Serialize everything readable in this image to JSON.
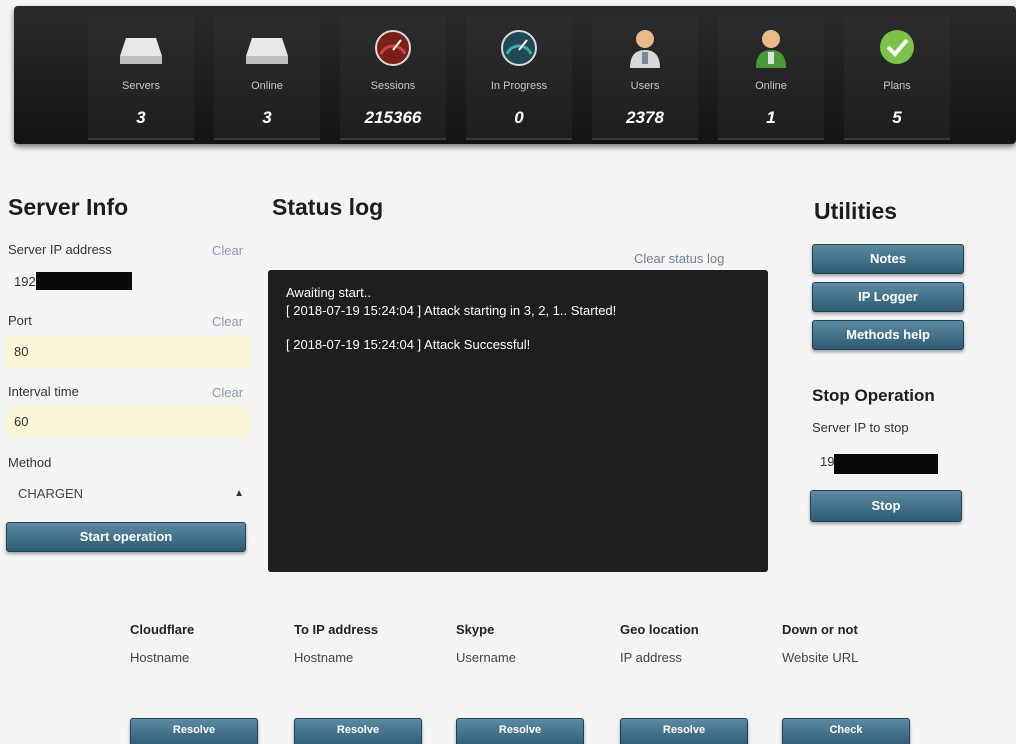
{
  "stats": [
    {
      "label": "Servers",
      "value": "3",
      "icon": "server-icon"
    },
    {
      "label": "Online",
      "value": "3",
      "icon": "server-icon"
    },
    {
      "label": "Sessions",
      "value": "215366",
      "icon": "gauge-icon"
    },
    {
      "label": "In Progress",
      "value": "0",
      "icon": "gauge-icon"
    },
    {
      "label": "Users",
      "value": "2378",
      "icon": "user-icon"
    },
    {
      "label": "Online",
      "value": "1",
      "icon": "user-icon"
    },
    {
      "label": "Plans",
      "value": "5",
      "icon": "check-icon"
    }
  ],
  "server_info": {
    "title": "Server Info",
    "ip_label": "Server IP address",
    "ip_value": "192",
    "port_label": "Port",
    "port_value": "80",
    "interval_label": "Interval time",
    "interval_value": "60",
    "method_label": "Method",
    "method_value": "CHARGEN",
    "clear_label": "Clear",
    "start_button": "Start operation"
  },
  "status_log": {
    "title": "Status log",
    "clear_link": "Clear status log",
    "lines": [
      "Awaiting start..",
      "[ 2018-07-19 15:24:04 ] Attack starting in 3, 2, 1.. Started!",
      "[ 2018-07-19 15:24:04 ] Attack Successful!"
    ]
  },
  "utilities": {
    "title": "Utilities",
    "notes_button": "Notes",
    "ip_logger_button": "IP Logger",
    "methods_help_button": "Methods help",
    "stop_title": "Stop Operation",
    "stop_ip_label": "Server IP to stop",
    "stop_ip_value": "19",
    "stop_button": "Stop"
  },
  "tools": [
    {
      "title": "Cloudflare",
      "placeholder": "Hostname",
      "button": "Resolve"
    },
    {
      "title": "To IP address",
      "placeholder": "Hostname",
      "button": "Resolve"
    },
    {
      "title": "Skype",
      "placeholder": "Username",
      "button": "Resolve"
    },
    {
      "title": "Geo location",
      "placeholder": "IP address",
      "button": "Resolve"
    },
    {
      "title": "Down or not",
      "placeholder": "Website URL",
      "button": "Check"
    }
  ],
  "colors": {
    "button_top": "#5c8aa0",
    "button_bottom": "#2e5a72",
    "input_highlight": "#fbf8d9",
    "log_background": "#1e1e1e"
  }
}
